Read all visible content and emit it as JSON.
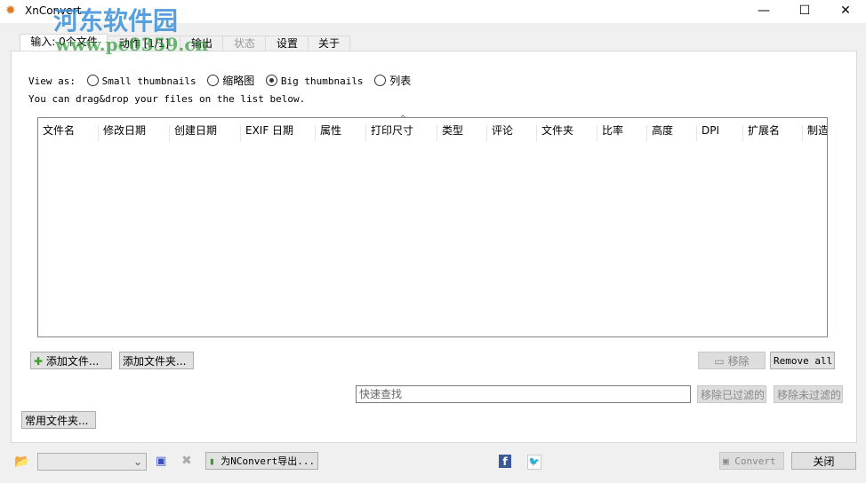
{
  "window": {
    "title": "XnConvert",
    "minimize": "—",
    "maximize": "☐",
    "close": "✕"
  },
  "watermark": {
    "title": "河东软件园",
    "url": "www.pc0359.cn"
  },
  "tabs": [
    {
      "label": "输入: 0个文件",
      "active": true
    },
    {
      "label": "动作 [1/1]"
    },
    {
      "label": "输出"
    },
    {
      "label": "状态",
      "disabled": true
    },
    {
      "label": "设置"
    },
    {
      "label": "关于"
    }
  ],
  "view": {
    "label": "View as:",
    "options": [
      {
        "label": "Small thumbnails",
        "selected": false
      },
      {
        "label": "缩略图",
        "selected": false
      },
      {
        "label": "Big thumbnails",
        "selected": true
      },
      {
        "label": "列表",
        "selected": false
      }
    ],
    "hint": "You can drag&drop your files on the list below."
  },
  "columns": [
    "文件名",
    "修改日期",
    "创建日期",
    "EXIF 日期",
    "属性",
    "打印尺寸",
    "类型",
    "评论",
    "文件夹",
    "比率",
    "高度",
    "DPI",
    "扩展名",
    "制造"
  ],
  "buttons": {
    "add_files": "添加文件...",
    "add_folder": "添加文件夹...",
    "remove": "移除",
    "remove_all": "Remove all",
    "remove_filtered": "移除已过滤的",
    "remove_unfiltered": "移除未过滤的",
    "favorites": "常用文件夹...",
    "export": "为NConvert导出...",
    "convert": "Convert",
    "close": "关闭"
  },
  "search": {
    "placeholder": "快速查找",
    "value": ""
  },
  "preset": {
    "value": ""
  },
  "colors": {
    "facebook": "#3b5998",
    "twitter": "#55acee",
    "add_icon": "#3a9a2a"
  }
}
